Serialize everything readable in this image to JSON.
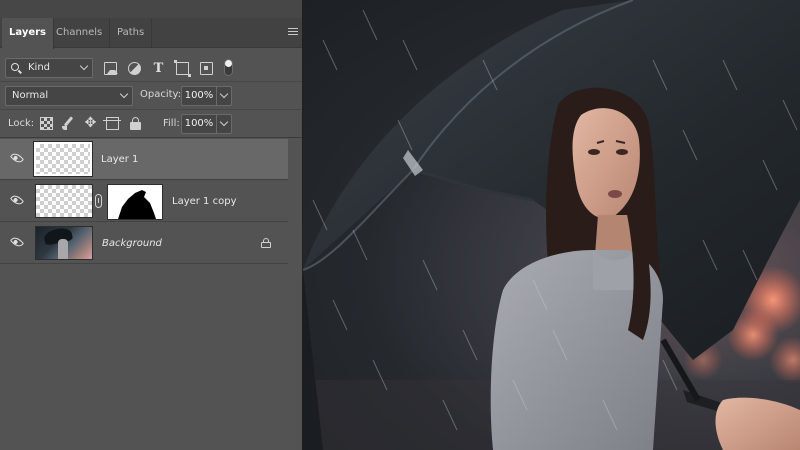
{
  "panel": {
    "tabs": [
      {
        "label": "Layers",
        "active": true
      },
      {
        "label": "Channels",
        "active": false
      },
      {
        "label": "Paths",
        "active": false
      }
    ],
    "menu_icon": "hamburger-menu-icon"
  },
  "filter": {
    "kind_label": "Kind",
    "filter_icons": [
      "pixel-layer-filter-icon",
      "adjustment-layer-filter-icon",
      "type-layer-filter-icon",
      "shape-layer-filter-icon",
      "smart-object-filter-icon"
    ]
  },
  "blend": {
    "mode": "Normal",
    "opacity_label": "Opacity:",
    "opacity_value": "100%"
  },
  "lock": {
    "label": "Lock:",
    "fill_label": "Fill:",
    "fill_value": "100%"
  },
  "layers": [
    {
      "name": "Layer 1",
      "selected": true,
      "visible": true,
      "has_mask": false,
      "locked": false
    },
    {
      "name": "Layer 1 copy",
      "selected": false,
      "visible": true,
      "has_mask": true,
      "locked": false
    },
    {
      "name": "Background",
      "selected": false,
      "visible": true,
      "has_mask": false,
      "locked": true
    }
  ],
  "colors": {
    "panel_bg": "#535353",
    "selected_row": "#686868",
    "tab_bar": "#424242"
  }
}
